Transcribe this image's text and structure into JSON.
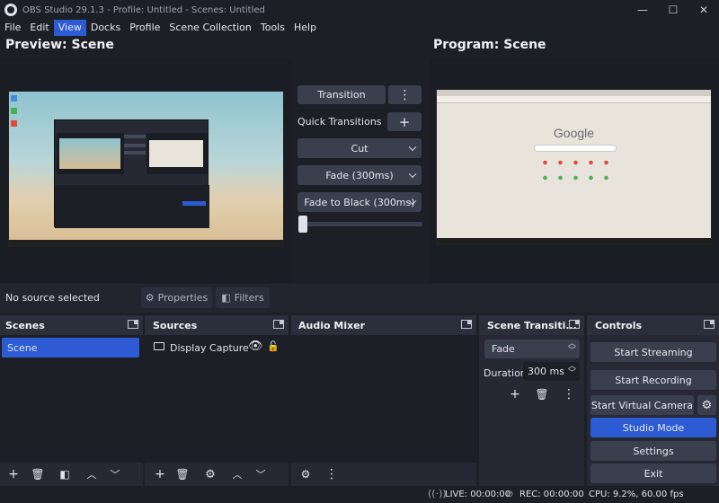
{
  "window": {
    "title": "OBS Studio 29.1.3 - Profile: Untitled - Scenes: Untitled",
    "minimize": "—",
    "maximize": "☐",
    "close": "✕"
  },
  "menu": [
    "File",
    "Edit",
    "View",
    "Docks",
    "Profile",
    "Scene Collection",
    "Tools",
    "Help"
  ],
  "preview": {
    "title": "Preview: Scene"
  },
  "program": {
    "title": "Program: Scene"
  },
  "transition_panel": {
    "transition_label": "Transition",
    "quick_transitions_label": "Quick Transitions",
    "quick": [
      "Cut",
      "Fade (300ms)",
      "Fade to Black (300ms)"
    ]
  },
  "program_screen": {
    "logo_text": "Google"
  },
  "source_bar": {
    "no_source": "No source selected",
    "properties": "Properties",
    "filters": "Filters"
  },
  "scenes": {
    "title": "Scenes",
    "items": [
      "Scene"
    ]
  },
  "sources": {
    "title": "Sources",
    "items": [
      {
        "name": "Display Capture"
      }
    ]
  },
  "audio_mixer": {
    "title": "Audio Mixer"
  },
  "scene_transitions": {
    "title": "Scene Transiti...",
    "selected": "Fade",
    "duration_label": "Duration",
    "duration_value": "300 ms"
  },
  "controls": {
    "title": "Controls",
    "start_streaming": "Start Streaming",
    "start_recording": "Start Recording",
    "start_virtual_camera": "Start Virtual Camera",
    "studio_mode": "Studio Mode",
    "settings": "Settings",
    "exit": "Exit"
  },
  "statusbar": {
    "live": "LIVE: 00:00:00",
    "rec": "REC: 00:00:00",
    "cpu": "CPU: 9.2%, 60.00 fps"
  },
  "colors": {
    "accent": "#2d5bd3",
    "panel": "#262934",
    "background": "#1d1f26"
  }
}
